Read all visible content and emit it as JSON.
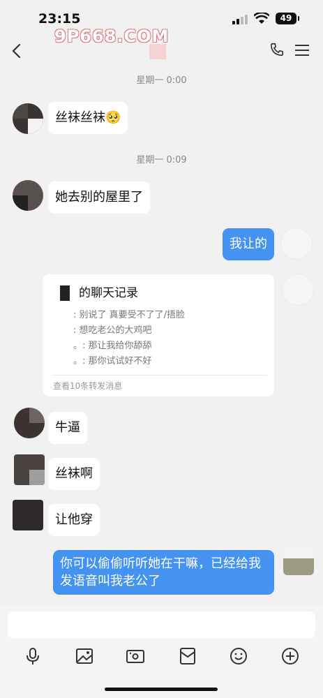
{
  "status_bar": {
    "time": "23:15",
    "battery": "49"
  },
  "watermark": "9P668.COM",
  "chat": {
    "timestamps": [
      "星期一 0:00",
      "星期一 0:09"
    ],
    "messages": {
      "m1": "丝袜丝袜🥺",
      "m2": "她去别的屋里了",
      "m3": "我让的",
      "m4": "牛逼",
      "m5": "丝袜啊",
      "m6": "让他穿",
      "m7": "你可以偷偷听听她在干嘛，已经给我发语音叫我老公了"
    },
    "forward": {
      "title": "的聊天记录",
      "lines": [
        ": 别说了 真要受不了了/捂脸",
        ": 想吃老公的大鸡吧",
        "。: 那让我给你舔舔",
        "。: 那你试试好不好"
      ],
      "footer": "查看10条转发消息"
    }
  },
  "colors": {
    "accent": "#4593f0",
    "background": "#f1f1f1",
    "watermark": "#e07a86"
  }
}
